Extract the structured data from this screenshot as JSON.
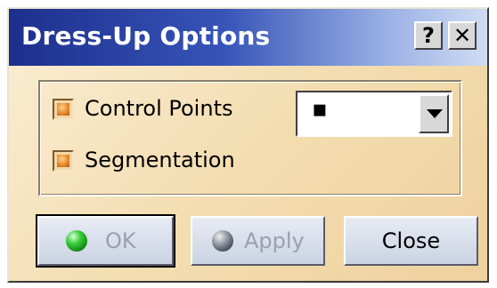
{
  "dialog": {
    "title": "Dress-Up Options",
    "help_label": "?",
    "close_label": "✕"
  },
  "options": {
    "control_points_label": "Control Points",
    "segmentation_label": "Segmentation",
    "marker_style_value": "▪"
  },
  "buttons": {
    "ok_label": "OK",
    "apply_label": "Apply",
    "close_label": "Close"
  }
}
